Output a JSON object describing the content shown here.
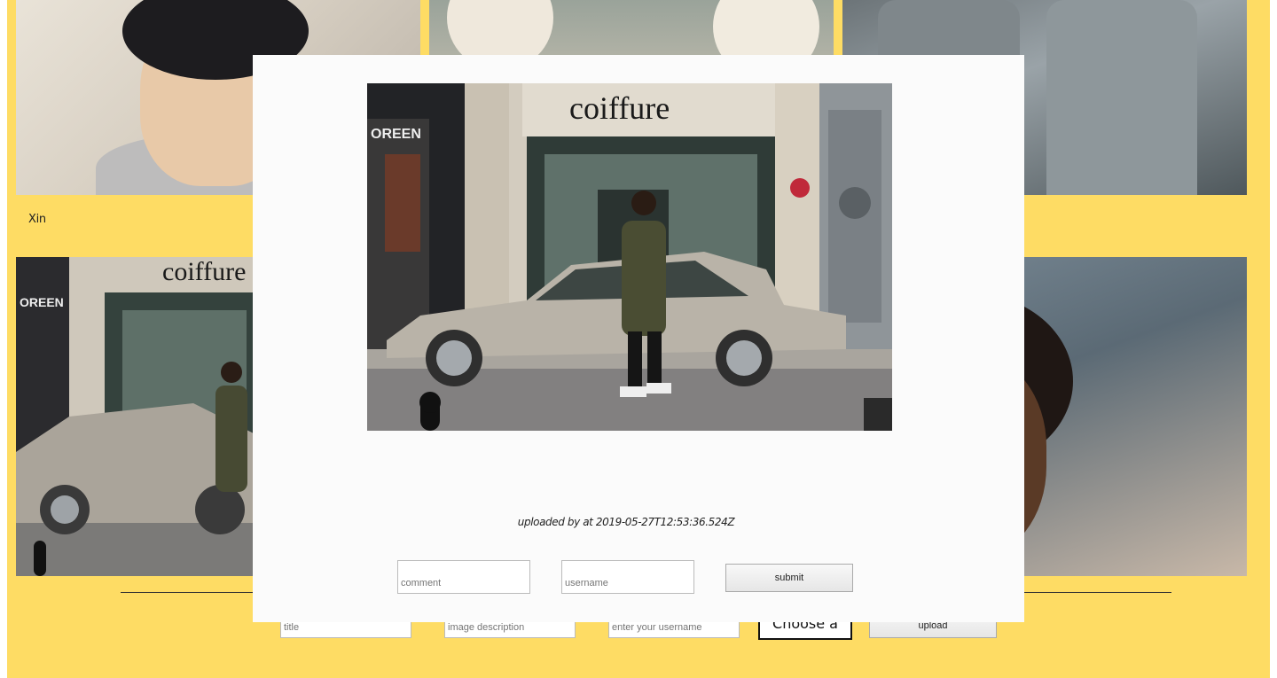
{
  "gallery": {
    "caption_first": "Xin"
  },
  "photo_scene": {
    "shop_sign": "coiffure",
    "shop_sign_left": "OREEN"
  },
  "upload_form": {
    "title_placeholder": "title",
    "description_placeholder": "image description",
    "username_placeholder": "enter your username",
    "choose_file_label": "Choose a file",
    "upload_button": "upload"
  },
  "modal": {
    "uploaded_meta": "uploaded by at 2019-05-27T12:53:36.524Z",
    "comment_placeholder": "comment",
    "username_placeholder": "username",
    "submit_button": "submit"
  },
  "colors": {
    "page_background": "#fedc64",
    "modal_background": "#fbfbfb"
  }
}
